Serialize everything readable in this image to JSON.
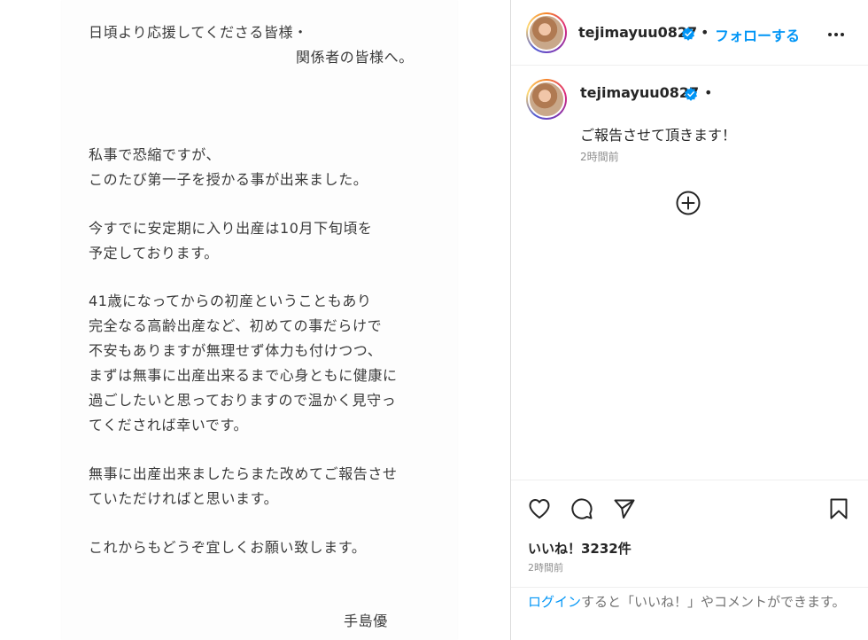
{
  "letter": {
    "lines": [
      "日頃より応援してくださる皆様・",
      "関係者の皆様へ。",
      "私事で恐縮ですが、",
      "このたび第一子を授かる事が出来ました。",
      "今すでに安定期に入り出産は10月下旬頃を",
      "予定しております。",
      "41歳になってからの初産ということもあり",
      "完全なる高齢出産など、初めての事だらけで",
      "不安もありますが無理せず体力も付けつつ、",
      "まずは無事に出産出来るまで心身ともに健康に",
      "過ごしたいと思っておりますので温かく見守っ",
      "てくだされば幸いです。",
      "無事に出産出来ましたらまた改めてご報告させ",
      "ていただければと思います。",
      "これからもどうぞ宜しくお願い致します。",
      "手島優"
    ]
  },
  "header": {
    "username": "tejimayuu0827",
    "separator": "•",
    "follow_label": "フォローする"
  },
  "caption": {
    "username": "tejimayuu0827",
    "separator": "•",
    "text": "ご報告させて頂きます！",
    "time": "2時間前"
  },
  "engagement": {
    "likes": "いいね！3232件",
    "time": "2時間前"
  },
  "footer": {
    "login_link": "ログイン",
    "login_rest": "すると「いいね！」やコメントができます。"
  },
  "colors": {
    "accent": "#0095f6",
    "verified": "#0095f6",
    "text": "#262626",
    "muted": "#8e8e8e"
  },
  "icons": [
    "verified-badge-icon",
    "more-options-icon",
    "add-comment-icon",
    "heart-icon",
    "comment-icon",
    "share-icon",
    "bookmark-icon"
  ]
}
